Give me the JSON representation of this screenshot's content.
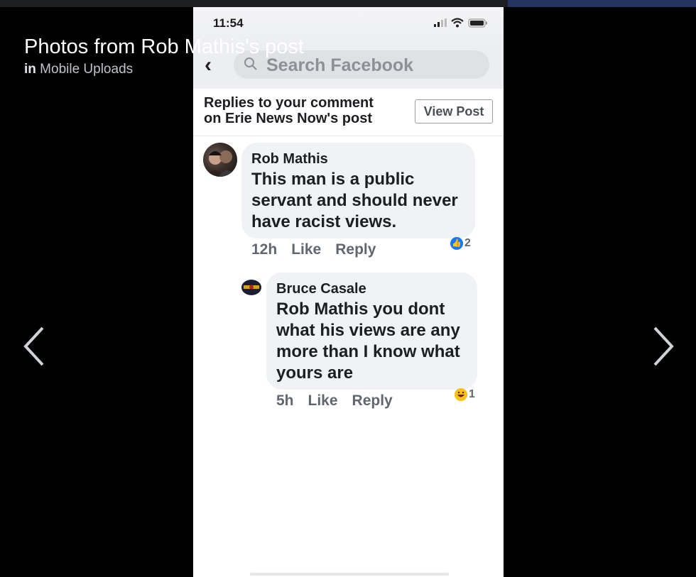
{
  "viewer": {
    "title": "Photos from Rob Mathis's post",
    "in_label": "in",
    "album": "Mobile Uploads"
  },
  "phone": {
    "time": "11:54",
    "search_placeholder": "Search Facebook",
    "replies_line1": "Replies to your comment",
    "replies_line2": "on Erie News Now's post",
    "view_post": "View Post"
  },
  "comments": [
    {
      "author": "Rob Mathis",
      "line1": "This man is a public",
      "line2": "servant and should never",
      "line3": "have racist views.",
      "time": "12h",
      "like": "Like",
      "reply": "Reply",
      "reaction_icon": "like-icon",
      "reaction_count": "2"
    },
    {
      "author": "Bruce Casale",
      "line1": "Rob Mathis you dont",
      "line2": "what his views are any",
      "line3": "more than I know what",
      "line4": "yours are",
      "time": "5h",
      "like": "Like",
      "reply": "Reply",
      "reaction_icon": "haha-icon",
      "reaction_count": "1"
    }
  ],
  "colors": {
    "background": "#000000",
    "accent": "#1877f2",
    "bubble": "#f0f2f5"
  }
}
